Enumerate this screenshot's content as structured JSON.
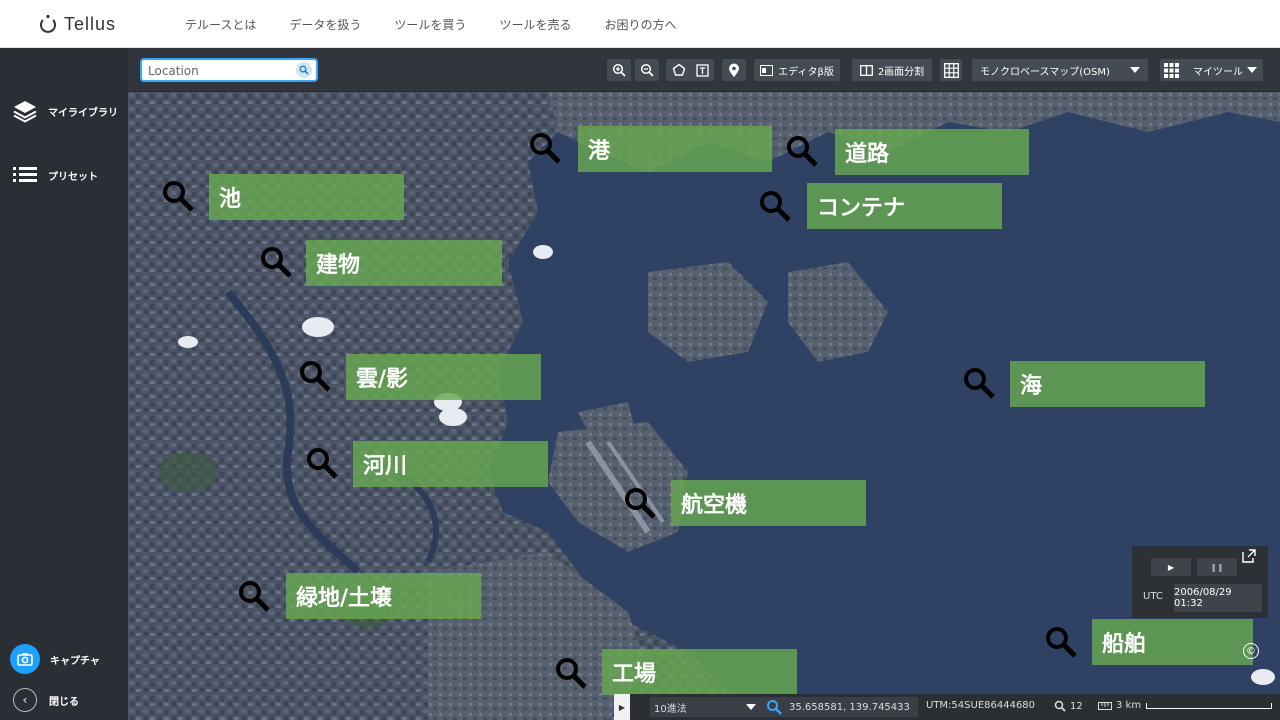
{
  "header": {
    "logo_text": "Tellus",
    "nav": [
      "テルースとは",
      "データを扱う",
      "ツールを買う",
      "ツールを売る",
      "お困りの方へ"
    ]
  },
  "sidebar": {
    "my_library": "マイライブラリ",
    "preset": "プリセット",
    "capture": "キャプチャ",
    "close": "閉じる"
  },
  "toolbar": {
    "search_placeholder": "Location",
    "editor_label": "エディタβ版",
    "split_label": "2画面分割",
    "basemap_label": "モノクロベースマップ(OSM)",
    "mytool_label": "マイツール"
  },
  "map": {
    "labels": {
      "port": "港",
      "road": "道路",
      "container": "コンテナ",
      "pond": "池",
      "building": "建物",
      "cloud": "雲/影",
      "sea": "海",
      "river": "河川",
      "aircraft": "航空機",
      "green": "緑地/土壌",
      "ship": "船舶",
      "factory": "工場"
    },
    "label_color": "#68a850"
  },
  "time_panel": {
    "utc": "UTC",
    "datetime": "2006/08/29 01:32"
  },
  "statusbar": {
    "coord_format": "10進法",
    "latlng": "35.658581, 139.745433",
    "utm": "UTM:54SUE86444680",
    "zoom": "12",
    "scale": "3 km"
  },
  "colors": {
    "accent": "#1ea0ff",
    "sidebar_bg": "#2a2f35",
    "toolbar_bg": "#31363c"
  }
}
